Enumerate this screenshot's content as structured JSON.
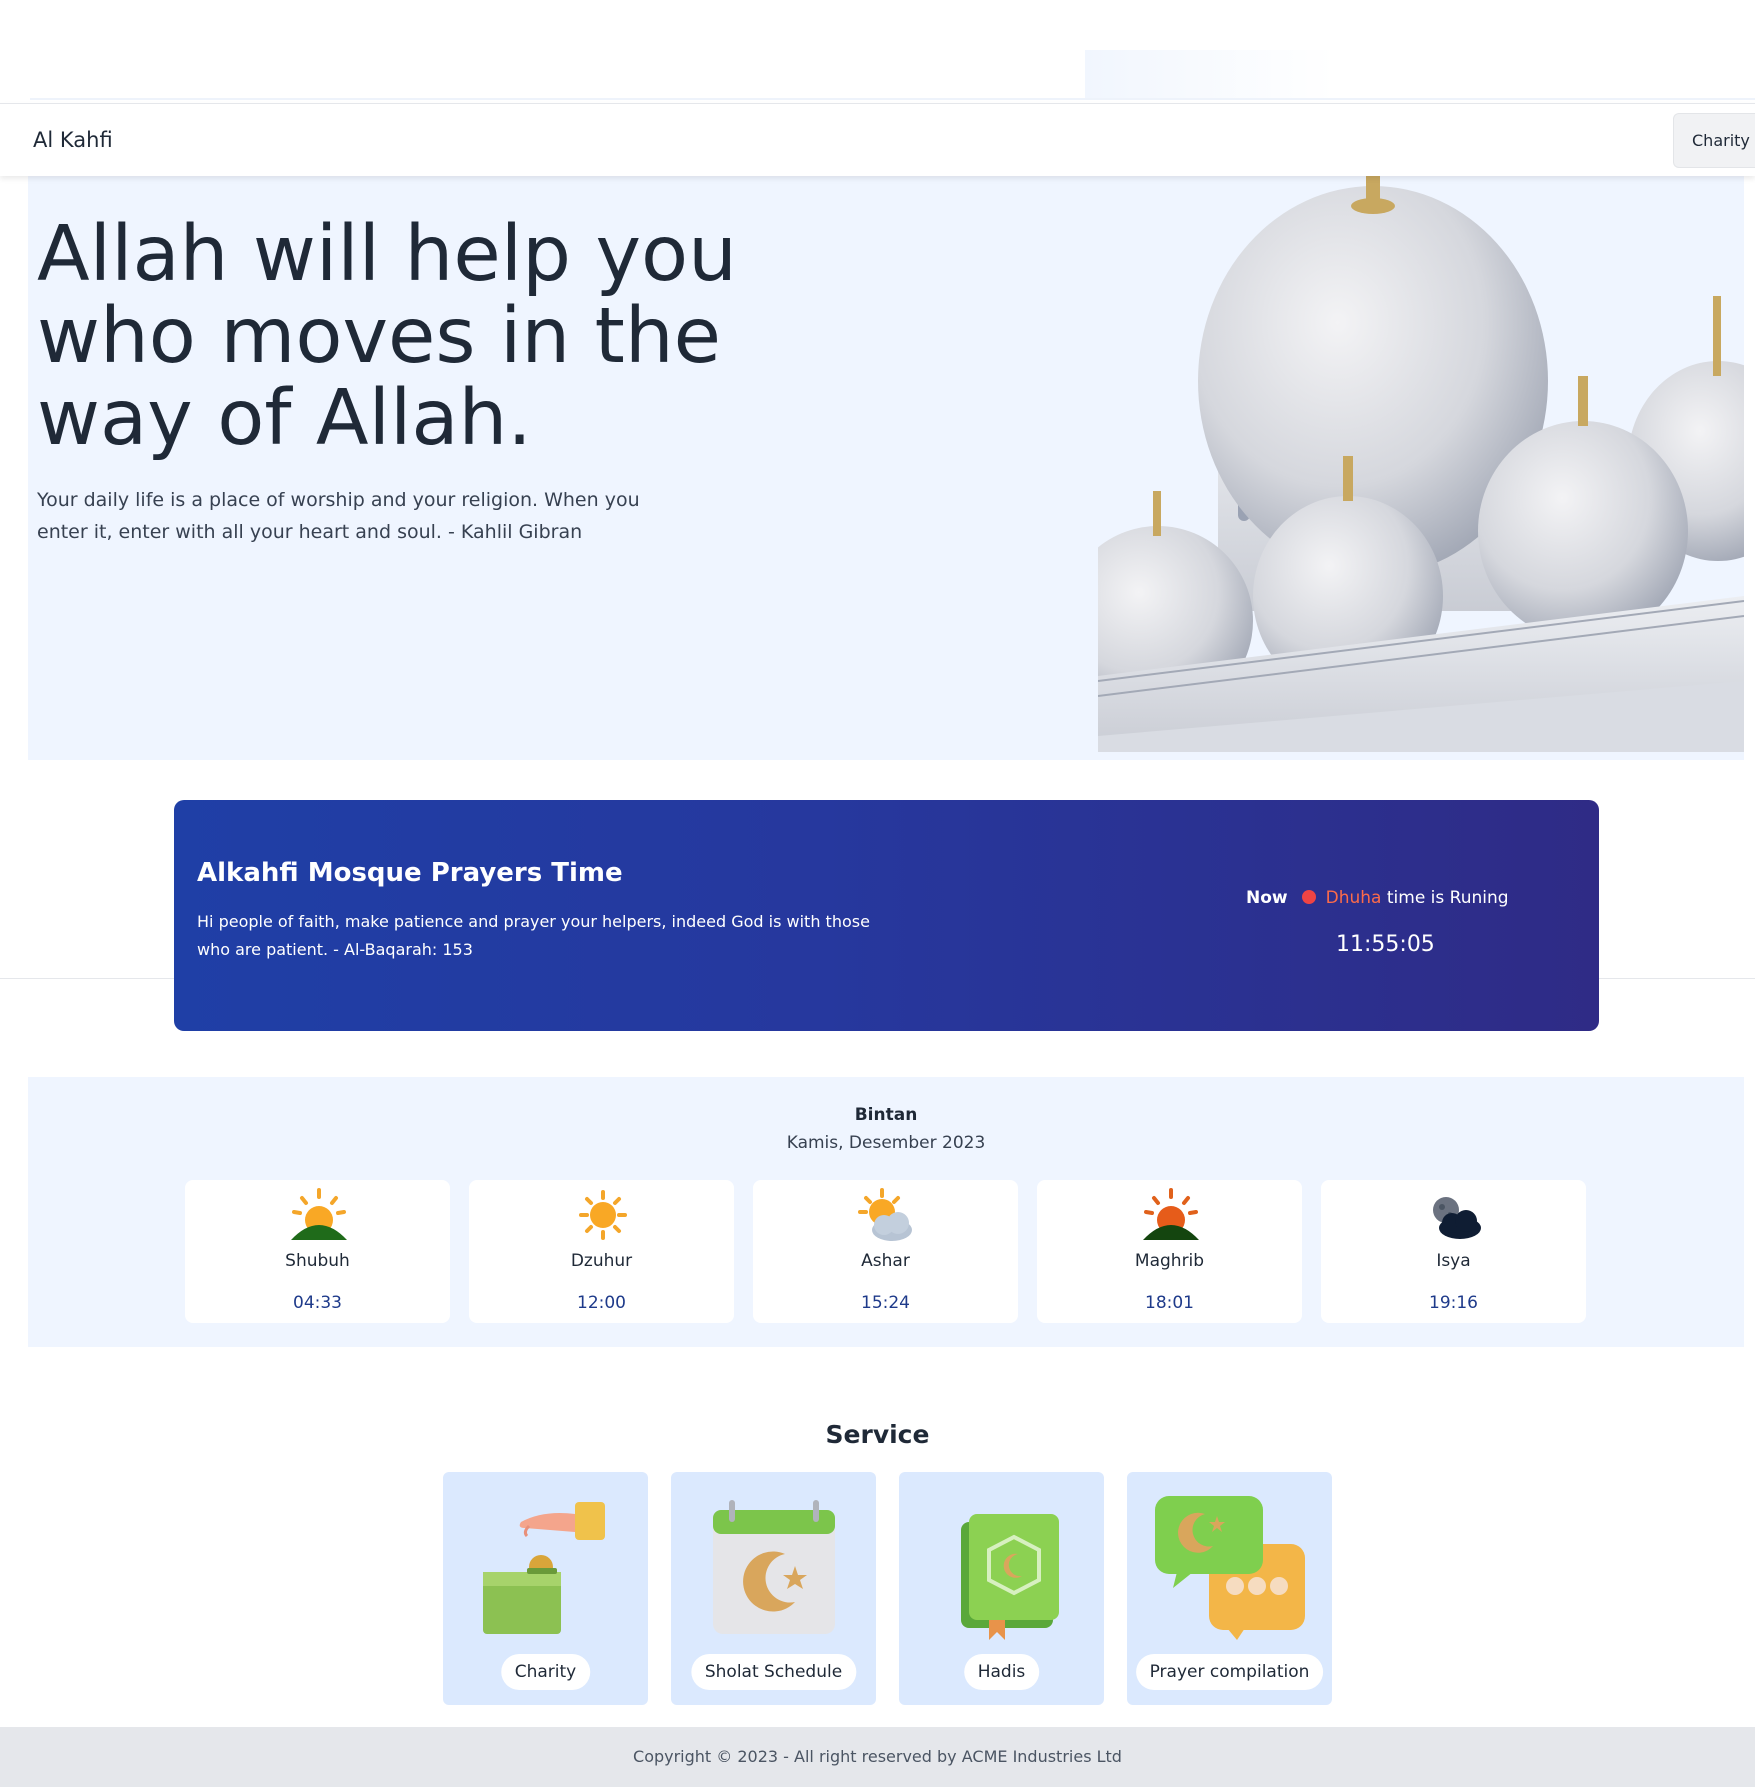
{
  "navbar": {
    "brand": "Al Kahfi",
    "charity_button": "Charity"
  },
  "hero": {
    "heading": "Allah will help you who moves in the way of Allah.",
    "quote": "Your daily life is a place of worship and your religion. When you enter it, enter with all your heart and soul. - Kahlil Gibran"
  },
  "prayer_banner": {
    "title": "Alkahfi Mosque Prayers Time",
    "verse": "Hi people of faith, make patience and prayer your helpers, indeed God is with those who are patient. - Al-Baqarah: 153",
    "now_label": "Now",
    "current_prayer": "Dhuha",
    "status_suffix": " time is Runing",
    "clock": "11:55:05",
    "colors": {
      "indicator": "#ef4444",
      "highlight": "#fb6b4a"
    }
  },
  "schedule": {
    "city": "Bintan",
    "date": "Kamis, Desember 2023",
    "prayers": [
      {
        "name": "Shubuh",
        "time": "04:33",
        "icon": "sunrise-icon"
      },
      {
        "name": "Dzuhur",
        "time": "12:00",
        "icon": "sun-icon"
      },
      {
        "name": "Ashar",
        "time": "15:24",
        "icon": "sun-cloud-icon"
      },
      {
        "name": "Maghrib",
        "time": "18:01",
        "icon": "sunset-icon"
      },
      {
        "name": "Isya",
        "time": "19:16",
        "icon": "moon-cloud-icon"
      }
    ]
  },
  "service": {
    "title": "Service",
    "items": [
      {
        "label": "Charity",
        "icon": "donation-icon"
      },
      {
        "label": "Sholat Schedule",
        "icon": "calendar-icon"
      },
      {
        "label": "Hadis",
        "icon": "book-icon"
      },
      {
        "label": "Prayer compilation",
        "icon": "chat-icon"
      }
    ]
  },
  "footer": {
    "copyright": "Copyright © 2023 - All right reserved by ACME Industries Ltd"
  }
}
